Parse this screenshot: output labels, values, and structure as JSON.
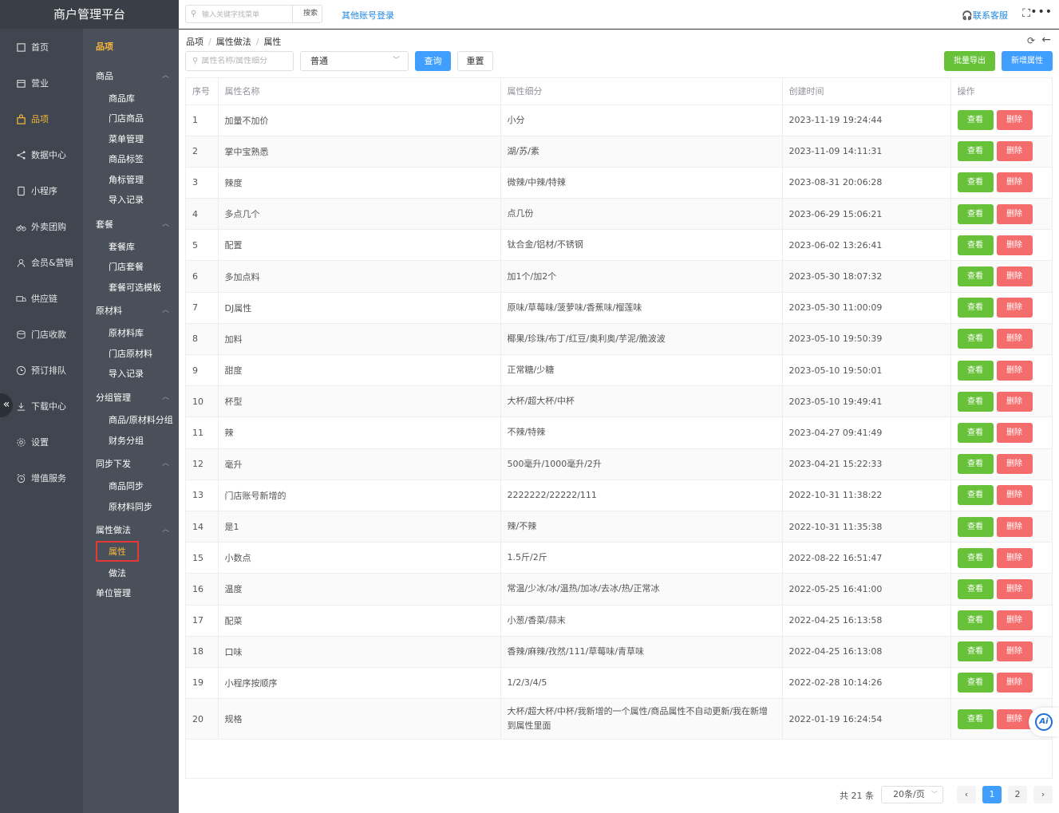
{
  "app": {
    "title": "商户管理平台"
  },
  "topbar": {
    "search_placeholder": "输入关键字找菜单",
    "search_button": "搜索",
    "other_login": "其他账号登录",
    "contact": "联系客服"
  },
  "nav": {
    "items": [
      {
        "label": "首页",
        "icon": "home-icon"
      },
      {
        "label": "营业",
        "icon": "calendar-icon"
      },
      {
        "label": "品项",
        "icon": "bag-icon",
        "active": true
      },
      {
        "label": "数据中心",
        "icon": "share-icon"
      },
      {
        "label": "小程序",
        "icon": "phone-icon"
      },
      {
        "label": "外卖团购",
        "icon": "bike-icon"
      },
      {
        "label": "会员&营销",
        "icon": "user-icon"
      },
      {
        "label": "供应链",
        "icon": "truck-icon"
      },
      {
        "label": "门店收款",
        "icon": "coins-icon"
      },
      {
        "label": "预订排队",
        "icon": "clock-icon"
      },
      {
        "label": "下载中心",
        "icon": "download-icon"
      },
      {
        "label": "设置",
        "icon": "gear-icon"
      },
      {
        "label": "增值服务",
        "icon": "alarm-icon"
      }
    ]
  },
  "subnav": {
    "title": "品项",
    "groups": {
      "g1": "商品",
      "g2": "套餐",
      "g3": "原材料",
      "g4": "分组管理",
      "g5": "同步下发",
      "g6": "属性做法",
      "g7": "单位管理"
    },
    "links": {
      "l1": "商品库",
      "l2": "门店商品",
      "l3": "菜单管理",
      "l4": "商品标签",
      "l5": "角标管理",
      "l6": "导入记录",
      "l7": "套餐库",
      "l8": "门店套餐",
      "l9": "套餐可选模板",
      "l10": "原材料库",
      "l11": "门店原材料",
      "l12": "导入记录",
      "l13": "商品/原材料分组",
      "l14": "财务分组",
      "l15": "商品同步",
      "l16": "原材料同步",
      "l17": "属性",
      "l18": "做法"
    }
  },
  "breadcrumb": [
    "品项",
    "属性做法",
    "属性"
  ],
  "filter": {
    "placeholder": "属性名称/属性细分",
    "select_value": "普通",
    "query": "查询",
    "reset": "重置",
    "export": "批量导出",
    "add": "新增属性"
  },
  "table": {
    "headers": [
      "序号",
      "属性名称",
      "属性细分",
      "创建时间",
      "操作"
    ],
    "view_label": "查看",
    "delete_label": "删除",
    "rows": [
      [
        "1",
        "加量不加价",
        "小分",
        "2023-11-19 19:24:44"
      ],
      [
        "2",
        "掌中宝熟悉",
        "湖/苏/素",
        "2023-11-09 14:11:31"
      ],
      [
        "3",
        "辣度",
        "微辣/中辣/特辣",
        "2023-08-31 20:06:28"
      ],
      [
        "4",
        "多点几个",
        "点几份",
        "2023-06-29 15:06:21"
      ],
      [
        "5",
        "配置",
        "钛合金/铝材/不锈钢",
        "2023-06-02 13:26:41"
      ],
      [
        "6",
        "多加点料",
        "加1个/加2个",
        "2023-05-30 18:07:32"
      ],
      [
        "7",
        "DJ属性",
        "原味/草莓味/菠萝味/香蕉味/榴莲味",
        "2023-05-30 11:00:09"
      ],
      [
        "8",
        "加料",
        "椰果/珍珠/布丁/红豆/奥利奥/芋泥/脆波波",
        "2023-05-10 19:50:39"
      ],
      [
        "9",
        "甜度",
        "正常糖/少糖",
        "2023-05-10 19:50:01"
      ],
      [
        "10",
        "杯型",
        "大杯/超大杯/中杯",
        "2023-05-10 19:49:41"
      ],
      [
        "11",
        "辣",
        "不辣/特辣",
        "2023-04-27 09:41:49"
      ],
      [
        "12",
        "毫升",
        "500毫升/1000毫升/2升",
        "2023-04-21 15:22:33"
      ],
      [
        "13",
        "门店账号新增的",
        "2222222/22222/111",
        "2022-10-31 11:38:22"
      ],
      [
        "14",
        "是1",
        "辣/不辣",
        "2022-10-31 11:35:38"
      ],
      [
        "15",
        "小数点",
        "1.5斤/2斤",
        "2022-08-22 16:51:47"
      ],
      [
        "16",
        "温度",
        "常温/少冰/冰/温热/加冰/去冰/热/正常冰",
        "2022-05-25 16:41:00"
      ],
      [
        "17",
        "配菜",
        "小葱/香菜/蒜末",
        "2022-04-25 16:13:58"
      ],
      [
        "18",
        "口味",
        "香辣/麻辣/孜然/111/草莓味/青草味",
        "2022-04-25 16:13:08"
      ],
      [
        "19",
        "小程序按顺序",
        "1/2/3/4/5",
        "2022-02-28 10:14:26"
      ],
      [
        "20",
        "规格",
        "大杯/超大杯/中杯/我新增的一个属性/商品属性不自动更新/我在新增到属性里面",
        "2022-01-19 16:24:54"
      ]
    ]
  },
  "pagination": {
    "total": "共 21 条",
    "page_size": "20条/页",
    "pages": [
      "1",
      "2"
    ],
    "current": "1"
  },
  "ai_badge": "Ai",
  "colors": {
    "primary": "#409eff",
    "success": "#67c23a",
    "danger": "#f56c6c",
    "active_nav": "#f7b73b",
    "sidebar_bg": "#3f4650"
  }
}
